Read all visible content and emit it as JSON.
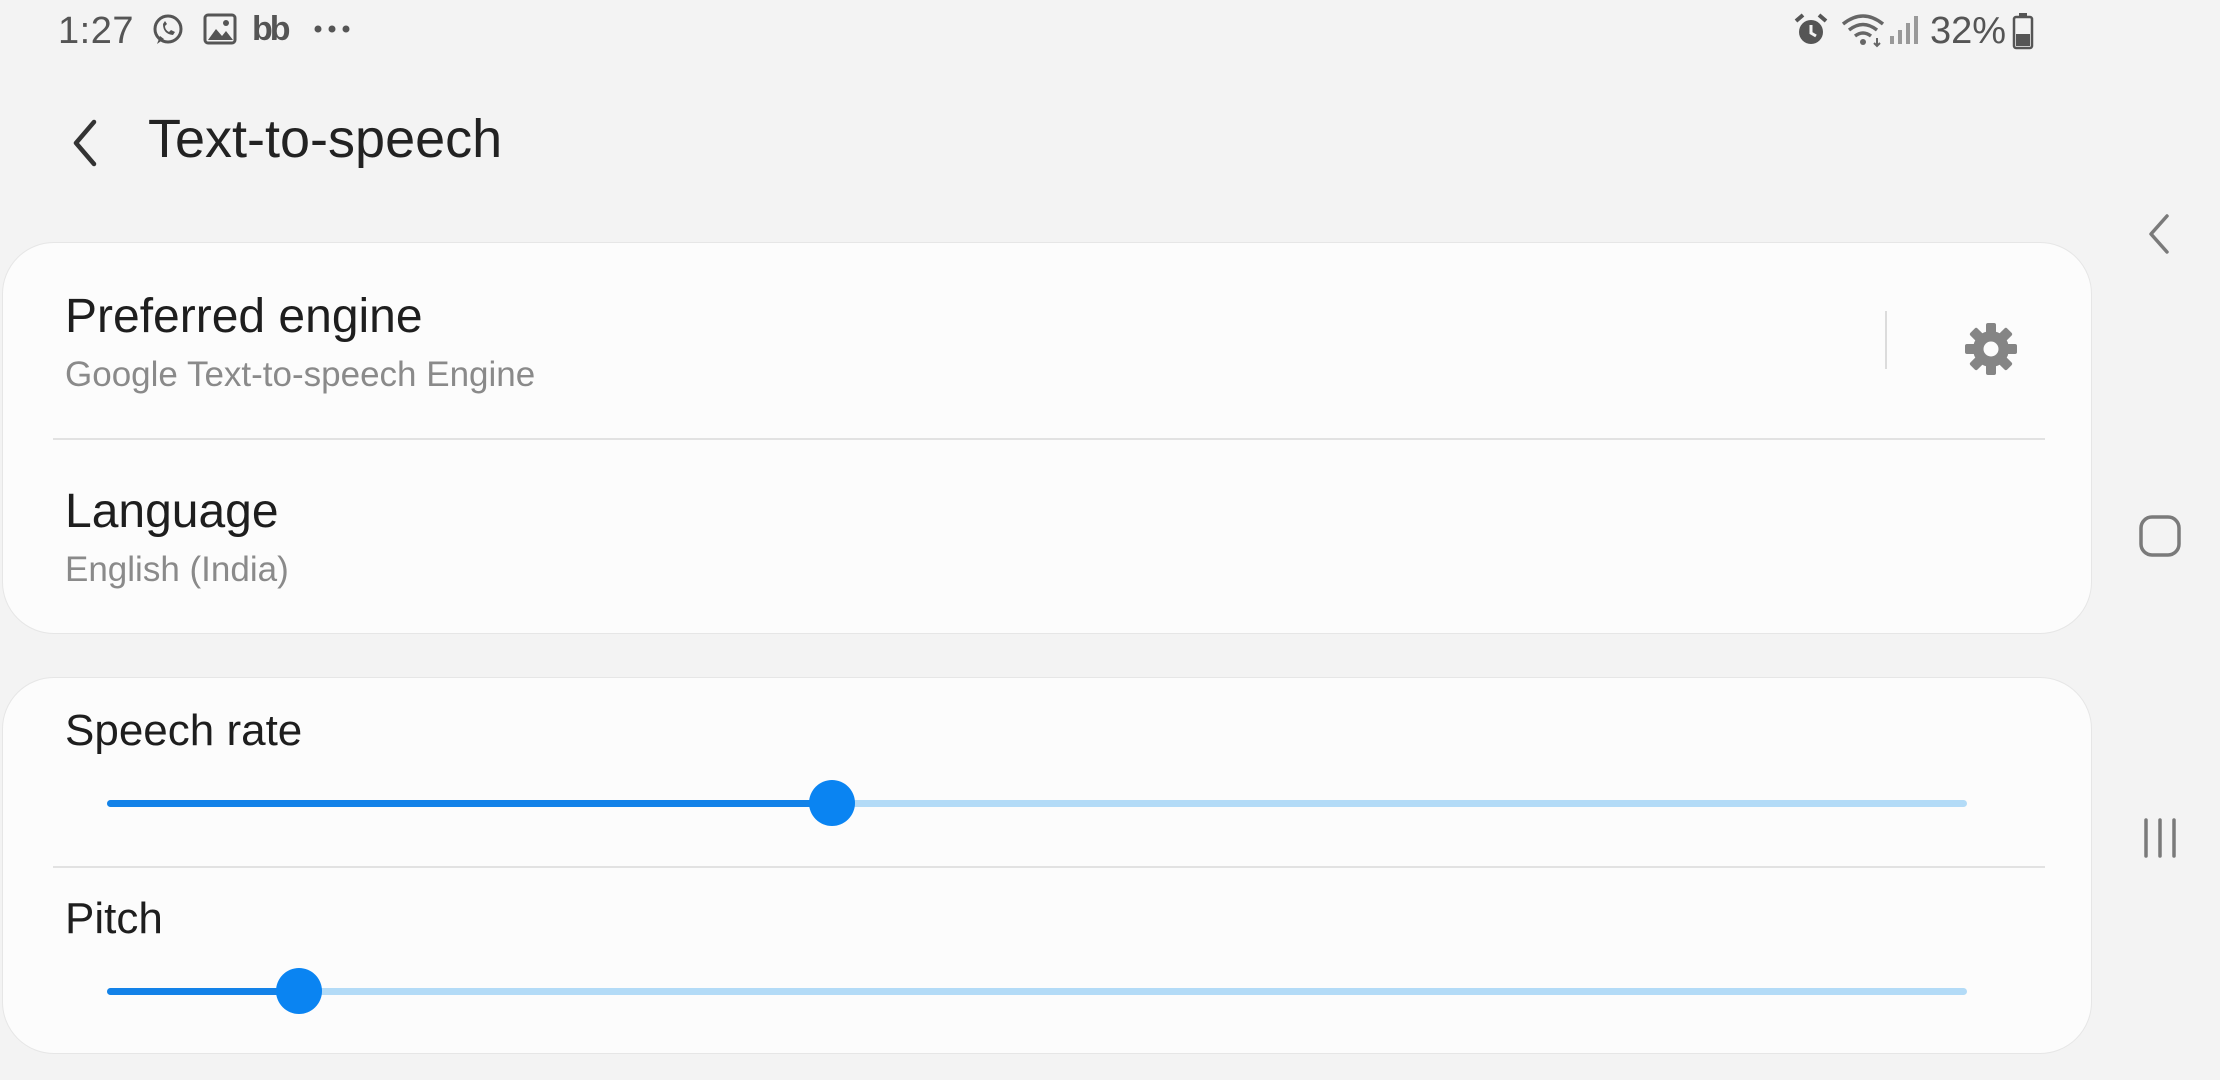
{
  "status_bar": {
    "time": "1:27",
    "notification_icons": [
      "whatsapp-icon",
      "gallery-icon",
      "bb-app-icon",
      "more-dots-icon"
    ],
    "system_icons": [
      "alarm-icon",
      "wifi-icon",
      "signal-icon",
      "battery-icon"
    ],
    "battery_percent": "32%",
    "bb_label": "bb"
  },
  "header": {
    "title": "Text-to-speech"
  },
  "settings": {
    "preferred_engine": {
      "title": "Preferred engine",
      "value": "Google Text-to-speech Engine"
    },
    "language": {
      "title": "Language",
      "value": "English (India)"
    },
    "speech_rate": {
      "title": "Speech rate",
      "level": 0.39
    },
    "pitch": {
      "title": "Pitch",
      "level": 0.103
    }
  },
  "nav_bar": {
    "buttons": [
      "back-icon",
      "home-icon",
      "recents-icon"
    ]
  },
  "colors": {
    "accent": "#0a84f2",
    "track_inactive": "#b3dbf7",
    "background": "#f3f3f3",
    "card": "#fcfcfc"
  }
}
